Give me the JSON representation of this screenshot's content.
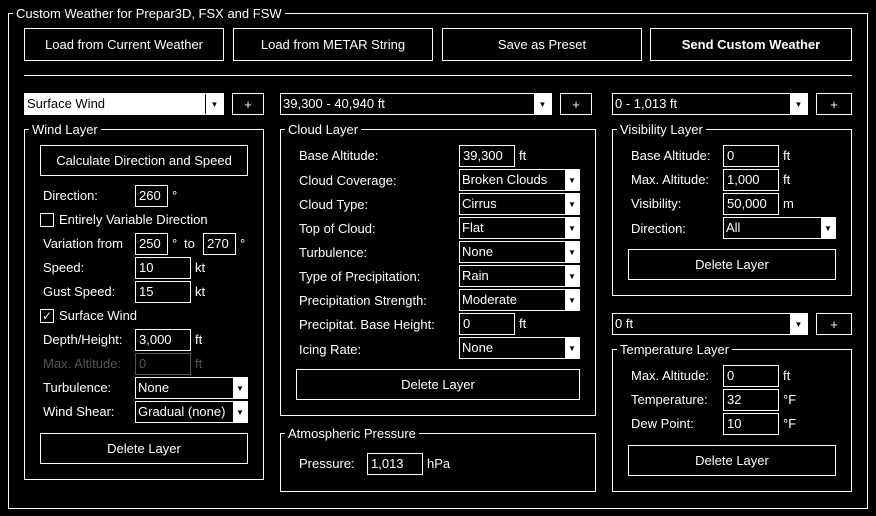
{
  "window": {
    "title": "Custom Weather for Prepar3D, FSX and FSW"
  },
  "toolbar": {
    "load_current": "Load from Current Weather",
    "load_metar": "Load from METAR String",
    "save_preset": "Save as Preset",
    "send_custom": "Send Custom Weather"
  },
  "wind": {
    "selector_value": "Surface Wind",
    "add_label": "+",
    "group_title": "Wind Layer",
    "calc_button": "Calculate Direction and Speed",
    "direction_label": "Direction:",
    "direction_value": "260",
    "direction_unit": "°",
    "variable_label": "Entirely Variable Direction",
    "variation_label": "Variation from",
    "variation_from": "250",
    "variation_from_unit": "°",
    "variation_to_label": "to",
    "variation_to": "270",
    "variation_to_unit": "°",
    "speed_label": "Speed:",
    "speed_value": "10",
    "speed_unit": "kt",
    "gust_label": "Gust Speed:",
    "gust_value": "15",
    "gust_unit": "kt",
    "surface_label": "Surface Wind",
    "surface_check": "✓",
    "depth_label": "Depth/Height:",
    "depth_value": "3,000",
    "depth_unit": "ft",
    "maxalt_label": "Max. Altitude:",
    "maxalt_value": "0",
    "maxalt_unit": "ft",
    "turbulence_label": "Turbulence:",
    "turbulence_value": "None",
    "shear_label": "Wind Shear:",
    "shear_value": "Gradual (none)",
    "delete_label": "Delete Layer"
  },
  "cloud": {
    "selector_value": "39,300 - 40,940 ft",
    "add_label": "+",
    "group_title": "Cloud Layer",
    "base_label": "Base Altitude:",
    "base_value": "39,300",
    "base_unit": "ft",
    "coverage_label": "Cloud Coverage:",
    "coverage_value": "Broken Clouds",
    "type_label": "Cloud Type:",
    "type_value": "Cirrus",
    "top_label": "Top of Cloud:",
    "top_value": "Flat",
    "turbulence_label": "Turbulence:",
    "turbulence_value": "None",
    "precip_type_label": "Type of Precipitation:",
    "precip_type_value": "Rain",
    "precip_strength_label": "Precipitation Strength:",
    "precip_strength_value": "Moderate",
    "precip_base_label": "Precipitat. Base Height:",
    "precip_base_value": "0",
    "precip_base_unit": "ft",
    "icing_label": "Icing Rate:",
    "icing_value": "None",
    "delete_label": "Delete Layer"
  },
  "pressure": {
    "group_title": "Atmospheric Pressure",
    "label": "Pressure:",
    "value": "1,013",
    "unit": "hPa"
  },
  "visibility": {
    "selector_value": "0 - 1,013 ft",
    "add_label": "+",
    "group_title": "Visibility Layer",
    "base_label": "Base Altitude:",
    "base_value": "0",
    "base_unit": "ft",
    "max_label": "Max. Altitude:",
    "max_value": "1,000",
    "max_unit": "ft",
    "vis_label": "Visibility:",
    "vis_value": "50,000",
    "vis_unit": "m",
    "dir_label": "Direction:",
    "dir_value": "All",
    "delete_label": "Delete Layer"
  },
  "temperature": {
    "selector_value": "0 ft",
    "add_label": "+",
    "group_title": "Temperature Layer",
    "max_label": "Max. Altitude:",
    "max_value": "0",
    "max_unit": "ft",
    "temp_label": "Temperature:",
    "temp_value": "32",
    "temp_unit": "°F",
    "dew_label": "Dew Point:",
    "dew_value": "10",
    "dew_unit": "°F",
    "delete_label": "Delete Layer"
  },
  "icons": {
    "dropdown": "chevron-down-icon",
    "check": "checkmark-icon"
  }
}
